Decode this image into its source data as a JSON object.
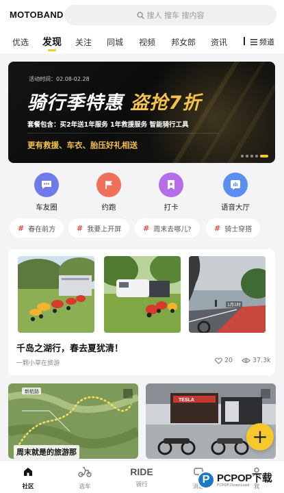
{
  "app": {
    "logo": "MOTOBAND"
  },
  "search": {
    "placeholder": "搜人 搜车 搜内容"
  },
  "tabs": [
    {
      "label": "优选"
    },
    {
      "label": "发现",
      "active": true
    },
    {
      "label": "关注"
    },
    {
      "label": "同城"
    },
    {
      "label": "视频"
    },
    {
      "label": "邦女郎"
    },
    {
      "label": "资讯"
    }
  ],
  "channels_label": "频道",
  "banner": {
    "date": "活动时间：02.08-02.28",
    "title_white": "骑行季特惠",
    "title_gold": "盗抢7折",
    "line1": "套餐包含：买2年送1年服务 1年救援服务 智能骑行工具",
    "line2": "更有救援、车衣、胎压好礼相送",
    "slide_count": 5,
    "active_slide": 5
  },
  "quick_actions": [
    {
      "label": "车友圈",
      "icon": "chat-bubble-icon",
      "color": "#6f7be8"
    },
    {
      "label": "约跑",
      "icon": "flag-icon",
      "color": "#f0705a"
    },
    {
      "label": "打卡",
      "icon": "bookmark-icon",
      "color": "#b56ee8"
    },
    {
      "label": "语音大厅",
      "icon": "voice-bars-icon",
      "color": "#5b8ef0"
    }
  ],
  "topics": [
    {
      "label": "春在前方"
    },
    {
      "label": "我要上开屏"
    },
    {
      "label": "周末去哪儿?"
    },
    {
      "label": "骑士穿搭"
    }
  ],
  "post": {
    "title": "千岛之湖行，春去夏犹清！",
    "author": "一颗小草在旅游",
    "likes": "20",
    "views": "37.3k",
    "photo_badge": "1月1时",
    "map_label": "新航路"
  },
  "feed": [
    {
      "caption": "周末就是的旅游那"
    },
    {
      "caption": "TESLA"
    }
  ],
  "bottom_nav": [
    {
      "label": "社区",
      "active": true,
      "icon": "home-icon"
    },
    {
      "label": "选车",
      "icon": "scooter-icon"
    },
    {
      "label": "骑行",
      "text": "RIDE"
    },
    {
      "label": "消息",
      "icon": "message-icon"
    },
    {
      "label": "我",
      "icon": "profile-icon"
    }
  ],
  "watermark": {
    "brand": "PCPOP下载",
    "sub": "PCPOP.DownLoad"
  },
  "colors": {
    "accent": "#f7c82b",
    "topic_hash": "#e64c4c",
    "brand_blue": "#1e78c8"
  }
}
